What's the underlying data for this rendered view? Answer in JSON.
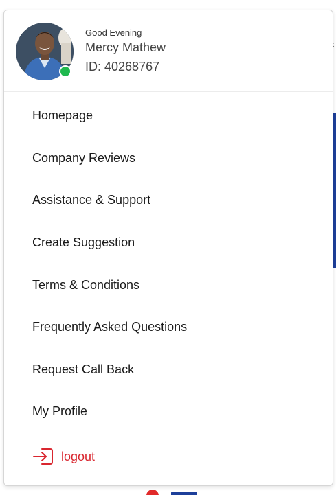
{
  "profile": {
    "greeting": "Good Evening",
    "name": "Mercy Mathew",
    "id_label": "ID: 40268767",
    "status": "online",
    "status_color": "#1fb84e"
  },
  "menu": {
    "items": [
      {
        "label": "Homepage"
      },
      {
        "label": "Company Reviews"
      },
      {
        "label": "Assistance & Support"
      },
      {
        "label": "Create Suggestion"
      },
      {
        "label": "Terms & Conditions"
      },
      {
        "label": "Frequently Asked Questions"
      },
      {
        "label": "Request Call Back"
      },
      {
        "label": "My Profile"
      }
    ],
    "logout": {
      "label": "logout",
      "icon": "logout-icon",
      "color": "#d9262f"
    }
  },
  "colors": {
    "accent_red": "#d9262f",
    "brand_blue": "#1d3f9a",
    "online_green": "#1fb84e"
  }
}
